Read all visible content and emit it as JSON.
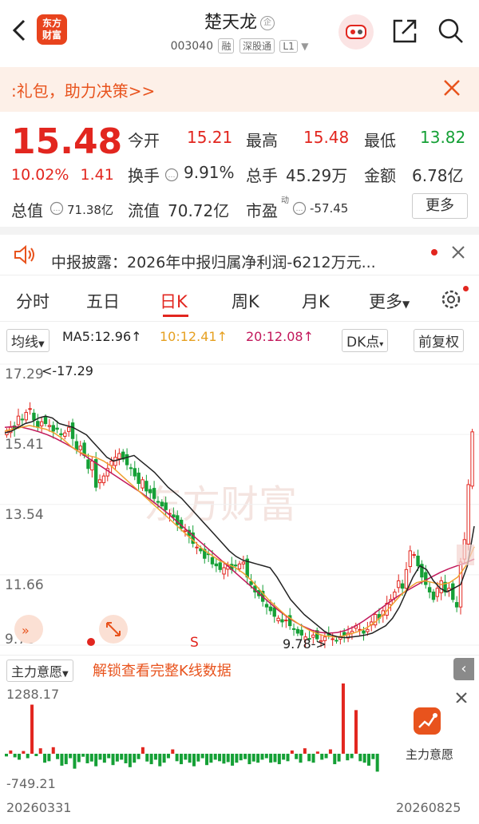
{
  "header": {
    "logo_line1": "东方",
    "logo_line2": "财富",
    "stock_name": "楚天龙",
    "corp_badge": "企",
    "stock_code": "003040",
    "tags": [
      "融",
      "深股通",
      "L1"
    ]
  },
  "banner": {
    "text": ":礼包，助力决策>>"
  },
  "quote": {
    "price": "15.48",
    "change_pct": "10.02%",
    "change": "1.41",
    "fields": [
      {
        "label": "今开",
        "value": "15.21",
        "color": "#e2261f"
      },
      {
        "label": "最高",
        "value": "15.48",
        "color": "#e2261f"
      },
      {
        "label": "最低",
        "value": "13.82",
        "color": "#15a036"
      },
      {
        "label": "换手",
        "value": "9.91%",
        "color": "#333333"
      },
      {
        "label": "总手",
        "value": "45.29万",
        "color": "#333333"
      },
      {
        "label": "金额",
        "value": "6.78亿",
        "color": "#333333"
      },
      {
        "label": "总值",
        "value": "71.38亿",
        "color": "#333333"
      },
      {
        "label": "流值",
        "value": "70.72亿",
        "color": "#333333"
      },
      {
        "label": "市盈",
        "value": "-57.45",
        "color": "#333333"
      }
    ],
    "pe_sup": "动",
    "more_label": "更多"
  },
  "notice": {
    "text": "中报披露：2026年中报归属净利润-6212万元..."
  },
  "tabs": [
    {
      "label": "分时"
    },
    {
      "label": "五日"
    },
    {
      "label": "日K"
    },
    {
      "label": "周K"
    },
    {
      "label": "月K"
    },
    {
      "label": "更多"
    }
  ],
  "ma_row": {
    "select_label": "均线",
    "ma5": "MA5:12.96",
    "ma10": "10:12.41",
    "ma20": "20:12.08",
    "dk_label": "DK点",
    "adjust_label": "前复权"
  },
  "colors": {
    "up": "#e2261f",
    "down": "#15a036",
    "ma5": "#222222",
    "ma10": "#f0a030",
    "ma20": "#c2185b",
    "accent": "#e8531d"
  },
  "chart_data": {
    "type": "candlestick",
    "title": "",
    "y_ticks": [
      "17.29",
      "15.41",
      "13.54",
      "11.66",
      "9.78"
    ],
    "ylim": [
      9.78,
      17.29
    ],
    "annotations": {
      "high": "<-17.29",
      "low": "9.78->",
      "signal": "S"
    },
    "close": [
      15.5,
      15.6,
      15.55,
      15.9,
      15.8,
      16.0,
      16.1,
      15.8,
      15.6,
      15.75,
      15.7,
      15.65,
      15.5,
      15.55,
      15.4,
      15.45,
      15.6,
      15.3,
      15.0,
      15.1,
      14.85,
      14.5,
      14.7,
      14.0,
      14.2,
      14.3,
      14.5,
      14.7,
      14.8,
      14.9,
      14.75,
      14.6,
      14.5,
      14.3,
      14.1,
      14.2,
      13.9,
      13.85,
      13.7,
      13.6,
      13.5,
      13.4,
      13.3,
      13.2,
      13.0,
      12.9,
      12.85,
      12.7,
      12.5,
      12.4,
      12.3,
      12.1,
      12.2,
      11.95,
      11.9,
      11.8,
      11.85,
      11.9,
      11.8,
      11.9,
      11.95,
      12.0,
      11.6,
      11.4,
      11.2,
      11.1,
      10.95,
      10.8,
      10.7,
      10.55,
      10.5,
      10.4,
      10.45,
      10.3,
      10.2,
      10.1,
      10.05,
      10.0,
      9.95,
      10.05,
      9.95,
      9.9,
      10.0,
      10.05,
      9.95,
      9.9,
      10.0,
      10.05,
      10.1,
      10.15,
      10.3,
      10.2,
      10.1,
      10.2,
      10.4,
      10.6,
      10.5,
      10.7,
      10.9,
      11.0,
      11.2,
      11.5,
      11.3,
      11.8,
      12.3,
      12.2,
      11.9,
      11.6,
      11.4,
      11.2,
      11.0,
      11.3,
      11.5,
      11.2,
      11.3,
      11.0,
      10.8,
      12.0,
      12.6,
      14.07,
      15.48
    ],
    "ma5": [
      15.45,
      15.5,
      15.6,
      15.7,
      15.75,
      15.85,
      15.9,
      15.85,
      15.7,
      15.65,
      15.6,
      15.5,
      15.4,
      15.2,
      15.0,
      14.8,
      14.7,
      14.75,
      14.8,
      14.85,
      14.7,
      14.55,
      14.4,
      14.2,
      14.0,
      13.85,
      13.7,
      13.5,
      13.3,
      13.1,
      12.9,
      12.7,
      12.5,
      12.3,
      12.15,
      12.05,
      12.0,
      11.95,
      11.9,
      11.85,
      11.6,
      11.3,
      11.0,
      10.8,
      10.6,
      10.45,
      10.3,
      10.15,
      10.05,
      10.0,
      9.98,
      10.0,
      10.02,
      10.05,
      10.1,
      10.2,
      10.3,
      10.5,
      10.8,
      11.2,
      11.6,
      11.9,
      11.8,
      11.5,
      11.3,
      11.2,
      11.3,
      11.4,
      11.9,
      12.96
    ],
    "ma10": [
      15.5,
      15.55,
      15.6,
      15.65,
      15.6,
      15.55,
      15.45,
      15.3,
      15.1,
      14.95,
      14.85,
      14.8,
      14.7,
      14.55,
      14.35,
      14.15,
      13.95,
      13.75,
      13.55,
      13.35,
      13.15,
      12.95,
      12.75,
      12.55,
      12.35,
      12.2,
      12.05,
      11.95,
      11.85,
      11.7,
      11.5,
      11.25,
      11.0,
      10.8,
      10.6,
      10.45,
      10.3,
      10.18,
      10.08,
      10.02,
      10.0,
      10.02,
      10.08,
      10.15,
      10.25,
      10.4,
      10.6,
      10.85,
      11.1,
      11.3,
      11.45,
      11.5,
      11.45,
      11.4,
      11.45,
      11.6,
      11.9,
      12.41
    ],
    "ma20": [
      15.6,
      15.62,
      15.6,
      15.55,
      15.48,
      15.4,
      15.3,
      15.18,
      15.05,
      14.9,
      14.75,
      14.6,
      14.45,
      14.3,
      14.15,
      14.0,
      13.85,
      13.68,
      13.5,
      13.32,
      13.12,
      12.92,
      12.72,
      12.52,
      12.32,
      12.12,
      11.92,
      11.72,
      11.52,
      11.32,
      11.12,
      10.92,
      10.72,
      10.55,
      10.4,
      10.28,
      10.18,
      10.12,
      10.1,
      10.12,
      10.18,
      10.28,
      10.42,
      10.58,
      10.75,
      10.92,
      11.08,
      11.22,
      11.35,
      11.48,
      11.6,
      11.72,
      11.82,
      11.9,
      11.98,
      12.08
    ]
  },
  "flow": {
    "select_label": "主力意愿",
    "unlock_text": "解锁查看完整K线数据",
    "max_label": "1288.17",
    "min_label": "-749.21",
    "card_label": "主力意愿",
    "values": [
      -90,
      60,
      -120,
      -200,
      50,
      -150,
      900,
      -80,
      100,
      -300,
      -250,
      120,
      -180,
      -400,
      -350,
      -150,
      -500,
      -280,
      -100,
      -320,
      -260,
      -420,
      -200,
      -300,
      -150,
      -380,
      -260,
      -200,
      -320,
      -450,
      -300,
      -180,
      120,
      -260,
      -350,
      -200,
      -420,
      -300,
      -150,
      80,
      -250,
      -350,
      -200,
      -300,
      -420,
      -260,
      -150,
      -380,
      -300,
      -200,
      -250,
      -330,
      -280,
      -400,
      -300,
      -220,
      -180,
      -350,
      -260,
      -300,
      -200,
      -150,
      -300,
      -280,
      -350,
      -200,
      -250,
      60,
      -180,
      -300,
      100,
      -250,
      -300,
      40,
      -200,
      -150,
      80,
      -350,
      -260,
      1288,
      -220,
      -150,
      800,
      -250,
      -300,
      -400,
      -180,
      -600
    ]
  },
  "dates": {
    "start": "20260331",
    "end": "20260825"
  }
}
